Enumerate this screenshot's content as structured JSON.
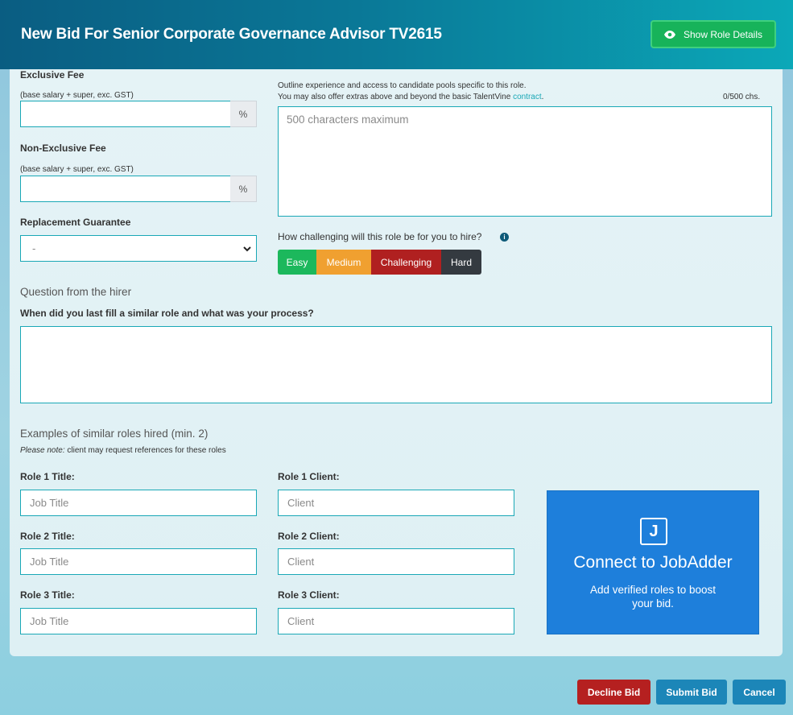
{
  "header": {
    "title": "New Bid For Senior Corporate Governance Advisor TV2615",
    "show_role_details": "Show Role Details"
  },
  "fees": {
    "exclusive_label": "Exclusive Fee",
    "exclusive_hint": "(base salary + super, exc. GST)",
    "exclusive_value": "",
    "non_exclusive_label": "Non-Exclusive Fee",
    "non_exclusive_hint": "(base salary + super, exc. GST)",
    "non_exclusive_value": "",
    "percent_symbol": "%",
    "replacement_label": "Replacement Guarantee",
    "replacement_value": "-"
  },
  "outline": {
    "line1": "Outline experience and access to candidate pools specific to this role.",
    "line2": "You may also offer extras above and beyond the basic TalentVine",
    "contract_link": "contract",
    "period": ".",
    "char_count": "0/500 chs.",
    "placeholder": "500 characters maximum"
  },
  "challenge": {
    "question": "How challenging will this role be for you to hire?",
    "info_icon": "i",
    "options": [
      {
        "label": "Easy",
        "color": "#1cb85c"
      },
      {
        "label": "Medium",
        "color": "#f0a030"
      },
      {
        "label": "Challenging",
        "color": "#b02020"
      },
      {
        "label": "Hard",
        "color": "#343a40"
      }
    ]
  },
  "hirer_question": {
    "section_title": "Question from the hirer",
    "question": "When did you last fill a similar role and what was your process?",
    "answer": ""
  },
  "similar_roles": {
    "section_title": "Examples of similar roles hired (min. 2)",
    "note_italic": "Please note:",
    "note_rest": " client may request references for these roles",
    "roles": [
      {
        "title_label": "Role 1 Title:",
        "client_label": "Role 1 Client:"
      },
      {
        "title_label": "Role 2 Title:",
        "client_label": "Role 2 Client:"
      },
      {
        "title_label": "Role 3 Title:",
        "client_label": "Role 3 Client:"
      }
    ],
    "title_placeholder": "Job Title",
    "client_placeholder": "Client"
  },
  "jobadder": {
    "logo_letter": "J",
    "title": "Connect to JobAdder",
    "subtitle": "Add verified roles to boost your bid."
  },
  "footer": {
    "decline": "Decline Bid",
    "submit": "Submit Bid",
    "cancel": "Cancel"
  },
  "colors": {
    "accent": "#1aa8b6",
    "decline": "#b52020",
    "submit": "#1c86b8",
    "cancel": "#1c86b8",
    "jobadder": "#1e7fdb"
  }
}
